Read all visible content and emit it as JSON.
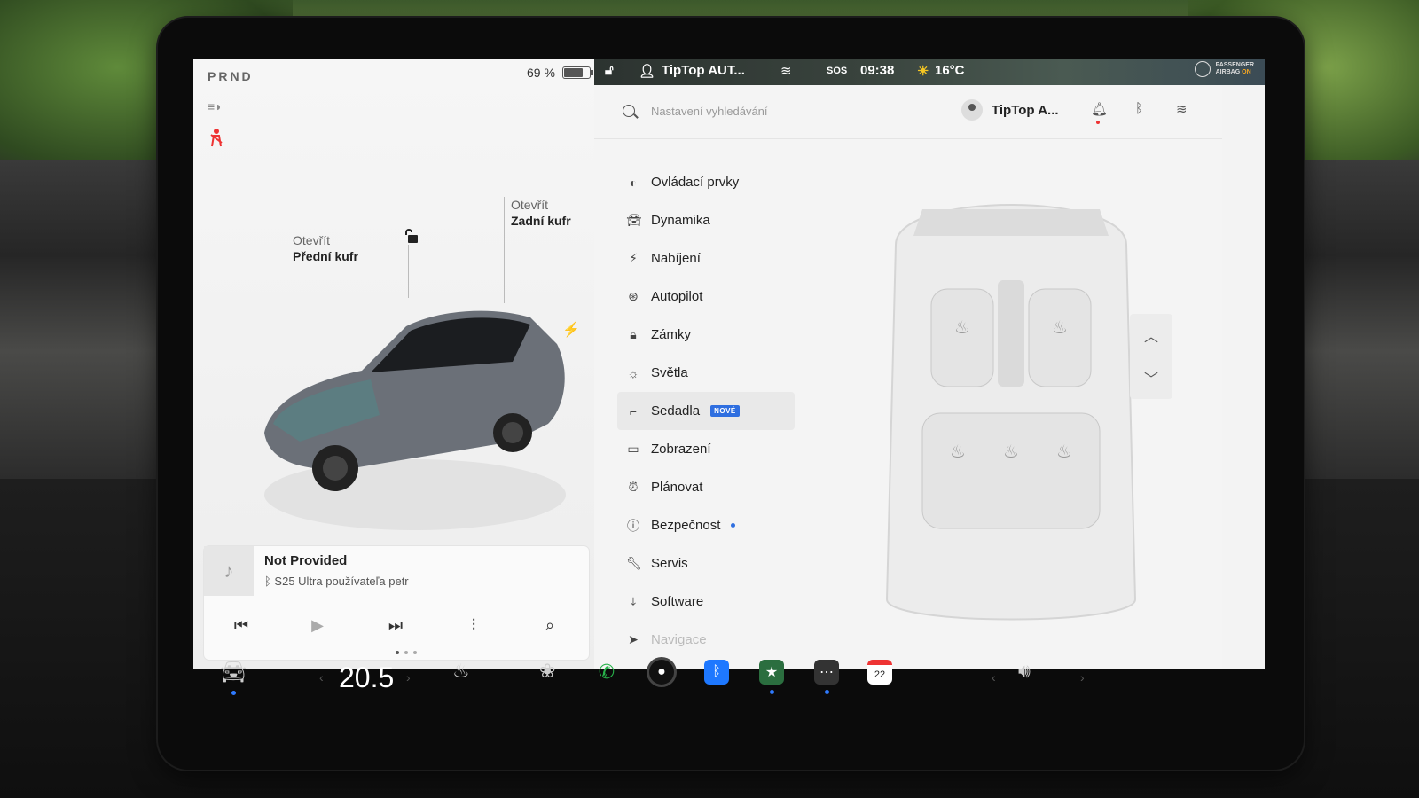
{
  "left_panel": {
    "gear": "PRND",
    "battery_percent_text": "69 %",
    "battery_level": 0.69,
    "frunk": {
      "line1": "Otevřít",
      "line2": "Přední kufr"
    },
    "trunk": {
      "line1": "Otevřít",
      "line2": "Zadní kufr"
    },
    "icons": [
      "headlight-icon",
      "seatbelt-warning-icon",
      "unlock-icon",
      "charge-port-icon"
    ]
  },
  "media": {
    "track": "Not Provided",
    "source": "S25 Ultra používateľa petr",
    "controls": [
      "previous-icon",
      "play-icon",
      "next-icon",
      "equalizer-icon",
      "search-icon"
    ]
  },
  "status_bar": {
    "profile": "TipTop AUT...",
    "sos": "SOS",
    "time": "09:38",
    "temperature": "16°C",
    "airbag_line1": "PASSENGER",
    "airbag_line2": "AIRBAG",
    "airbag_state": "ON"
  },
  "settings": {
    "search_placeholder": "Nastavení vyhledávání",
    "user_name": "TipTop A...",
    "menu": [
      {
        "label": "Ovládací prvky",
        "icon": "toggle-icon"
      },
      {
        "label": "Dynamika",
        "icon": "car-icon"
      },
      {
        "label": "Nabíjení",
        "icon": "bolt-icon"
      },
      {
        "label": "Autopilot",
        "icon": "steering-wheel-icon"
      },
      {
        "label": "Zámky",
        "icon": "lock-icon"
      },
      {
        "label": "Světla",
        "icon": "light-icon"
      },
      {
        "label": "Sedadla",
        "icon": "seat-icon",
        "badge": "NOVÉ",
        "active": true
      },
      {
        "label": "Zobrazení",
        "icon": "display-icon"
      },
      {
        "label": "Plánovat",
        "icon": "alarm-icon"
      },
      {
        "label": "Bezpečnost",
        "icon": "info-icon",
        "dot": true
      },
      {
        "label": "Servis",
        "icon": "wrench-icon"
      },
      {
        "label": "Software",
        "icon": "download-icon"
      },
      {
        "label": "Navigace",
        "icon": "navigation-icon",
        "faded": true
      }
    ]
  },
  "dock": {
    "temperature": "20.5",
    "calendar_day": "22",
    "apps": [
      "car-icon",
      "seat-heater-icon",
      "defrost-icon",
      "phone-icon",
      "camera-icon",
      "bluetooth-icon",
      "games-icon",
      "more-icon",
      "calendar-icon",
      "volume-icon"
    ]
  },
  "colors": {
    "accent": "#2f6fe0",
    "warning": "#e33333",
    "phone_green": "#28b34a",
    "airbag_on": "#f5a623"
  }
}
